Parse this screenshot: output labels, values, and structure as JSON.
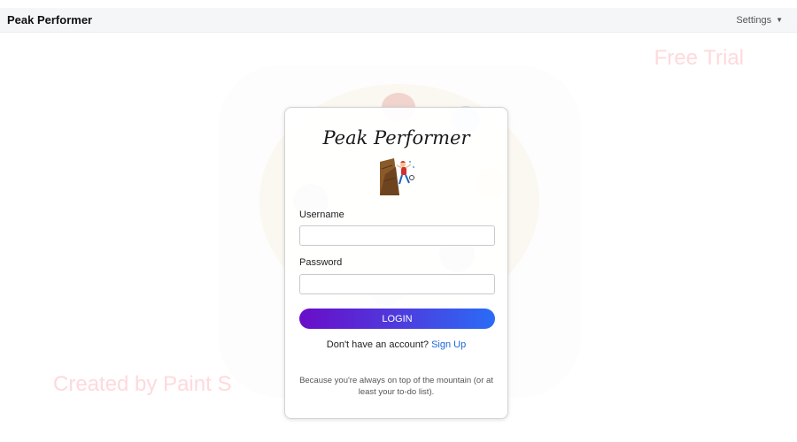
{
  "header": {
    "brand": "Peak Performer",
    "settings_label": "Settings"
  },
  "watermarks": {
    "top": "Free Trial",
    "bottom": "Created by Paint S"
  },
  "login": {
    "title": "Peak Performer",
    "logo_icon": "mountain-climber-icon",
    "username_label": "Username",
    "username_value": "",
    "password_label": "Password",
    "password_value": "",
    "button_label": "LOGIN",
    "signup_prompt": "Don't have an account?",
    "signup_link": "Sign Up",
    "tagline_line1": "Because you're always on top of the mountain (or at",
    "tagline_line2": "least your to-do list)."
  },
  "colors": {
    "button_gradient_start": "#6a0dc8",
    "button_gradient_end": "#2a6cf6",
    "link": "#1a66d8",
    "watermark": "#ffd9dc"
  }
}
